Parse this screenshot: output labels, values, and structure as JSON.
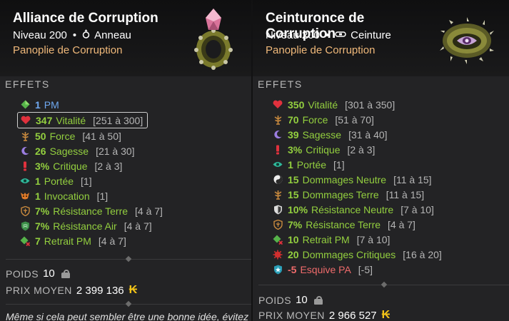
{
  "left": {
    "title": "Alliance de Corruption",
    "level_label": "Niveau 200",
    "type": "Anneau",
    "type_icon": "ring-icon",
    "set": "Panoplie de Corruption",
    "section_effects": "EFFETS",
    "effects": [
      {
        "value": "1",
        "label": "PM",
        "range": "",
        "icon": "pm-diamond-icon",
        "color": "blue"
      },
      {
        "value": "347",
        "label": "Vitalité",
        "range": "[251 à 300]",
        "icon": "heart-icon",
        "color": "green"
      },
      {
        "value": "50",
        "label": "Force",
        "range": "[41 à 50]",
        "icon": "force-icon",
        "color": "green"
      },
      {
        "value": "26",
        "label": "Sagesse",
        "range": "[21 à 30]",
        "icon": "moon-icon",
        "color": "green"
      },
      {
        "value": "3%",
        "label": "Critique",
        "range": "[2 à 3]",
        "icon": "critical-icon",
        "color": "green"
      },
      {
        "value": "1",
        "label": "Portée",
        "range": "[1]",
        "icon": "eye-icon",
        "color": "green"
      },
      {
        "value": "1",
        "label": "Invocation",
        "range": "[1]",
        "icon": "invocation-icon",
        "color": "green"
      },
      {
        "value": "7%",
        "label": "Résistance Terre",
        "range": "[4 à 7]",
        "icon": "shield-earth-icon",
        "color": "green"
      },
      {
        "value": "7%",
        "label": "Résistance Air",
        "range": "[4 à 7]",
        "icon": "shield-air-icon",
        "color": "green"
      },
      {
        "value": "7",
        "label": "Retrait PM",
        "range": "[4 à 7]",
        "icon": "pm-removal-icon",
        "color": "green"
      }
    ],
    "weight_label": "POIDS",
    "weight_value": "10",
    "price_label": "PRIX MOYEN",
    "price_value": "2 399 136",
    "description": "Même si cela peut sembler être une bonne idée, évitez"
  },
  "right": {
    "title": "Ceinturonce de Corruption",
    "level_label": "Niveau 200",
    "type": "Ceinture",
    "type_icon": "belt-icon",
    "set": "Panoplie de Corruption",
    "section_effects": "EFFETS",
    "effects": [
      {
        "value": "350",
        "label": "Vitalité",
        "range": "[301 à 350]",
        "icon": "heart-icon",
        "color": "green"
      },
      {
        "value": "70",
        "label": "Force",
        "range": "[51 à 70]",
        "icon": "force-icon",
        "color": "green"
      },
      {
        "value": "39",
        "label": "Sagesse",
        "range": "[31 à 40]",
        "icon": "moon-icon",
        "color": "green"
      },
      {
        "value": "3%",
        "label": "Critique",
        "range": "[2 à 3]",
        "icon": "critical-icon",
        "color": "green"
      },
      {
        "value": "1",
        "label": "Portée",
        "range": "[1]",
        "icon": "eye-icon",
        "color": "green"
      },
      {
        "value": "15",
        "label": "Dommages Neutre",
        "range": "[11 à 15]",
        "icon": "neutral-icon",
        "color": "green"
      },
      {
        "value": "15",
        "label": "Dommages Terre",
        "range": "[11 à 15]",
        "icon": "force-icon",
        "color": "green"
      },
      {
        "value": "10%",
        "label": "Résistance Neutre",
        "range": "[7 à 10]",
        "icon": "shield-neutral-icon",
        "color": "green"
      },
      {
        "value": "7%",
        "label": "Résistance Terre",
        "range": "[4 à 7]",
        "icon": "shield-earth-icon",
        "color": "green"
      },
      {
        "value": "10",
        "label": "Retrait PM",
        "range": "[7 à 10]",
        "icon": "pm-removal-icon",
        "color": "green"
      },
      {
        "value": "20",
        "label": "Dommages Critiques",
        "range": "[16 à 20]",
        "icon": "critical-damage-icon",
        "color": "green"
      },
      {
        "value": "-5",
        "label": "Esquive PA",
        "range": "[-5]",
        "icon": "pa-dodge-icon",
        "color": "red"
      }
    ],
    "weight_label": "POIDS",
    "weight_value": "10",
    "price_label": "PRIX MOYEN",
    "price_value": "2 966 527"
  },
  "colors": {
    "background": "#232325",
    "header": "#131314",
    "set_name": "#f0b97a",
    "effect_green": "#93cf3f",
    "effect_blue": "#6fa8f0",
    "effect_red": "#ef6b6b",
    "kama": "#f2c318"
  },
  "kama_icon": "kama-icon",
  "weight_icon": "weight-icon"
}
